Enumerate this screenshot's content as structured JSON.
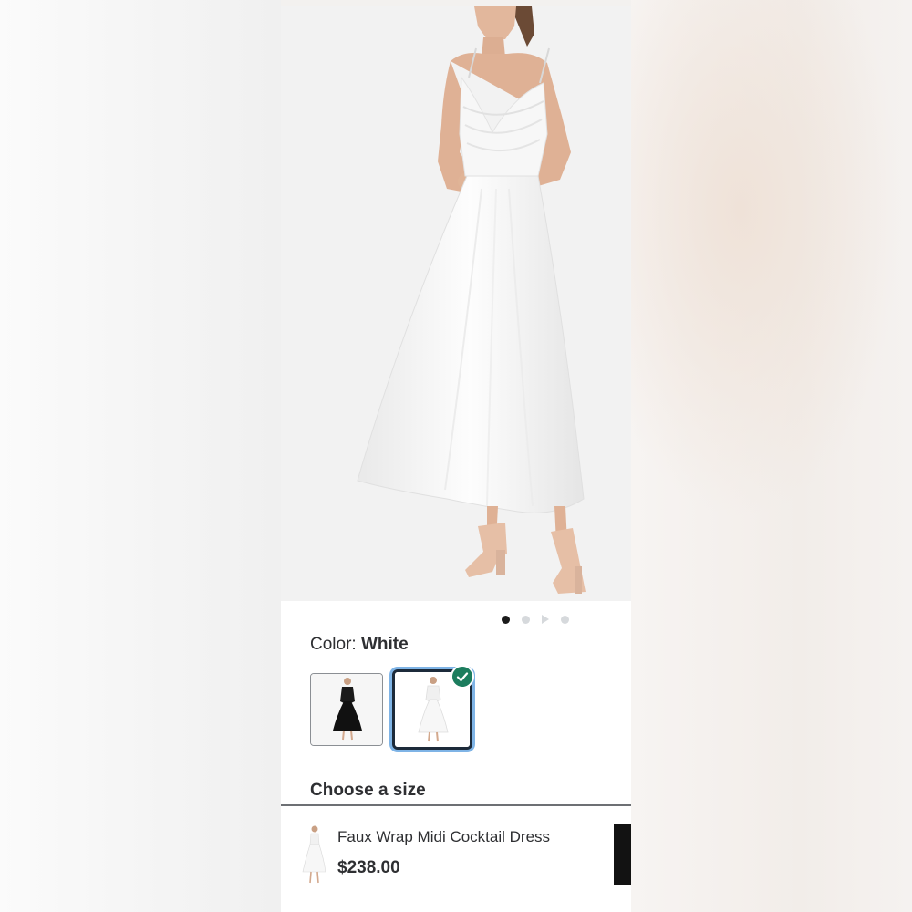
{
  "product": {
    "color_prefix": "Color: ",
    "color_value": "White",
    "swatches": [
      {
        "name": "Black",
        "selected": false
      },
      {
        "name": "White",
        "selected": true
      }
    ],
    "size_heading": "Choose a size",
    "name": "Faux Wrap Midi Cocktail Dress",
    "price": "$238.00"
  },
  "carousel": {
    "image_count": 4,
    "active_index": 0,
    "has_video": true
  },
  "colors": {
    "selected_check": "#1c7d5e",
    "selected_outline": "#7fb4e6",
    "text": "#2e2f32"
  },
  "icons": {
    "selected": "checkmark-icon",
    "video": "play-icon"
  }
}
